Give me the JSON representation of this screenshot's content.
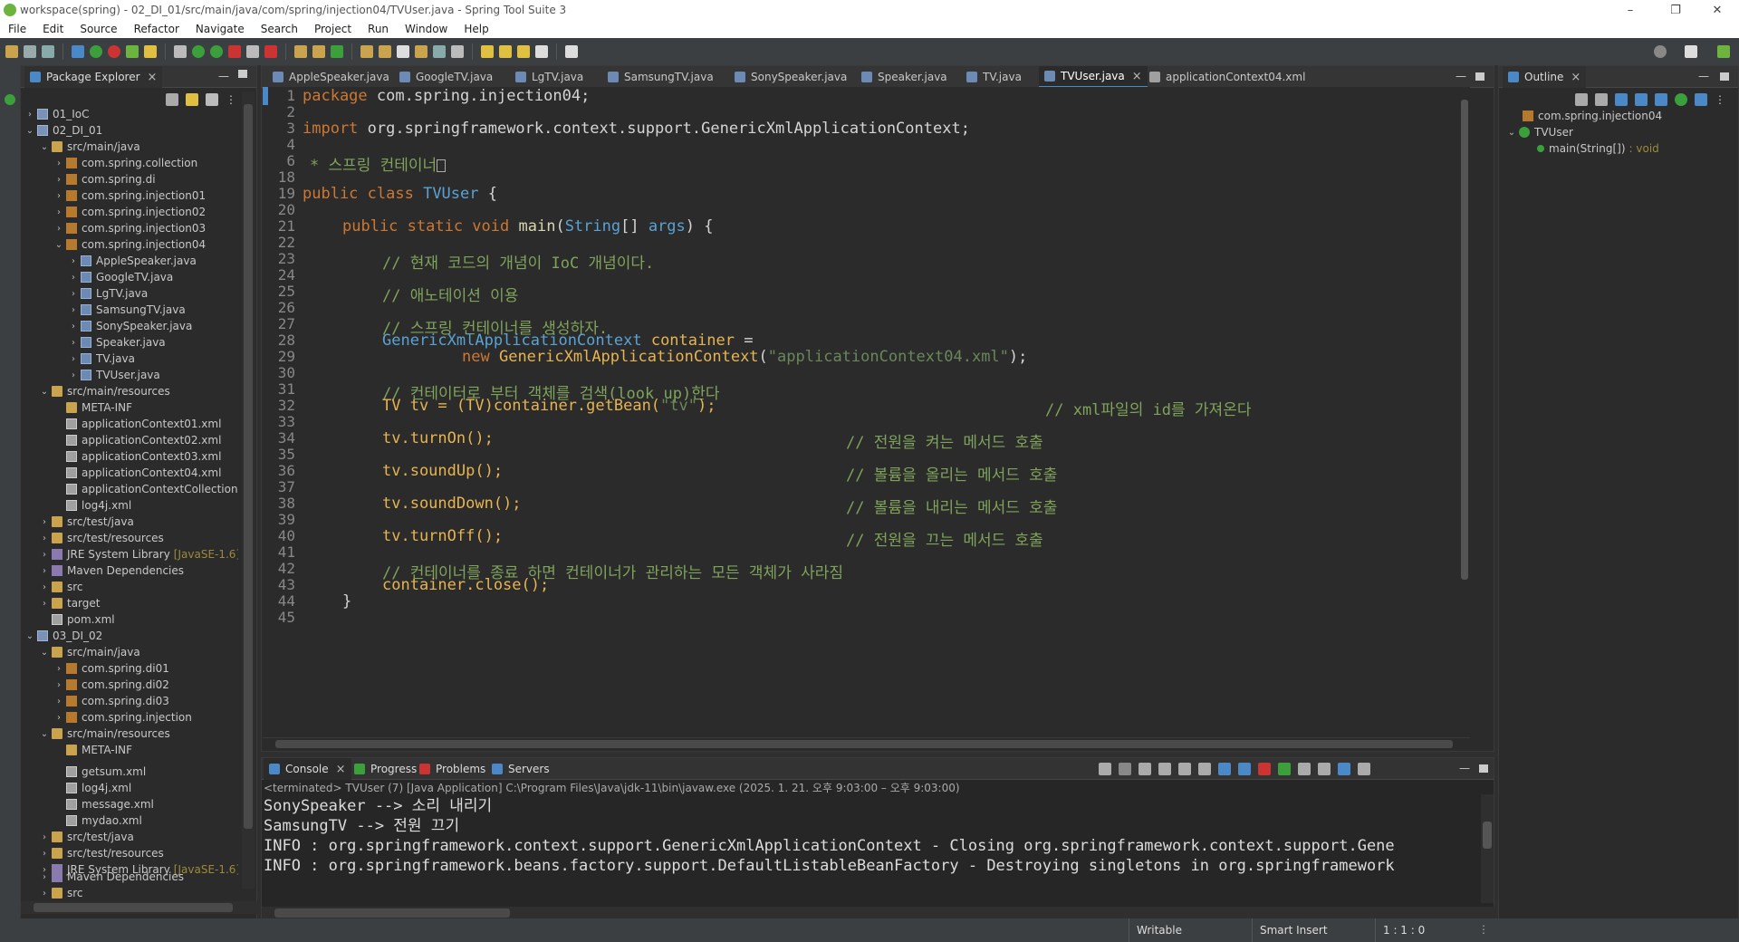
{
  "window": {
    "title": "workspace(spring) - 02_DI_01/src/main/java/com/spring/injection04/TVUser.java - Spring Tool Suite 3"
  },
  "menu": [
    "File",
    "Edit",
    "Source",
    "Refactor",
    "Navigate",
    "Search",
    "Project",
    "Run",
    "Window",
    "Help"
  ],
  "package_explorer": {
    "tab_label": "Package Explorer",
    "items": [
      "01_IoC",
      "02_DI_01",
      "src/main/java",
      "com.spring.collection",
      "com.spring.di",
      "com.spring.injection01",
      "com.spring.injection02",
      "com.spring.injection03",
      "com.spring.injection04",
      "AppleSpeaker.java",
      "GoogleTV.java",
      "LgTV.java",
      "SamsungTV.java",
      "SonySpeaker.java",
      "Speaker.java",
      "TV.java",
      "TVUser.java",
      "src/main/resources",
      "META-INF",
      "applicationContext01.xml",
      "applicationContext02.xml",
      "applicationContext03.xml",
      "applicationContext04.xml",
      "applicationContextCollection.xn",
      "log4j.xml",
      "src/test/java",
      "src/test/resources",
      "JRE System Library",
      "Maven Dependencies",
      "src",
      "target",
      "pom.xml",
      "03_DI_02",
      "src/main/java",
      "com.spring.di01",
      "com.spring.di02",
      "com.spring.di03",
      "com.spring.injection",
      "src/main/resources",
      "META-INF",
      "getsum.xml",
      "log4j.xml",
      "message.xml",
      "mydao.xml",
      "src/test/java",
      "src/test/resources",
      "JRE System Library",
      "Maven Dependencies",
      "src"
    ],
    "jre_suffix": "[JavaSE-1.6]"
  },
  "editor_tabs": [
    "AppleSpeaker.java",
    "GoogleTV.java",
    "LgTV.java",
    "SamsungTV.java",
    "SonySpeaker.java",
    "Speaker.java",
    "TV.java",
    "TVUser.java",
    "applicationContext04.xml"
  ],
  "active_tab": "TVUser.java",
  "code": {
    "line_numbers": [
      "1",
      "2",
      "3",
      "4",
      "6",
      "18",
      "19",
      "20",
      "21",
      "22",
      "23",
      "24",
      "25",
      "26",
      "27",
      "28",
      "29",
      "30",
      "31",
      "32",
      "33",
      "34",
      "35",
      "36",
      "37",
      "38",
      "39",
      "40",
      "41",
      "42",
      "43",
      "44",
      "45"
    ],
    "package_kw": "package",
    "package_name": "com.spring.injection04;",
    "import_kw": "import",
    "import_name": "org.springframework.context.support.GenericXmlApplicationContext;",
    "javadoc": "* 스프링 컨테이너",
    "class_kw": "public class",
    "class_name": "TVUser",
    "brace_open": "{",
    "main_kw": "public static void",
    "main_name": "main",
    "main_param_type": "String",
    "main_param_rest": "[] ",
    "main_param_name": "args",
    "main_tail": ") {",
    "c1": "// 현재 코드의 개념이 IoC 개념이다.",
    "c2": "// 애노테이션 이용",
    "c3": "// 스프링 컨테이너를 생성하자.",
    "l28_type": "GenericXmlApplicationContext",
    "l28_var": "container",
    "l28_eq": " =",
    "l29_new": "new",
    "l29_type": "GenericXmlApplicationContext",
    "l29_open": "(",
    "l29_str": "\"applicationContext04.xml\"",
    "l29_close": ");",
    "c4": "// 컨테이터로 부터 객체를 검색(look up)한다",
    "l32_code": "TV tv = (TV)container.getBean(",
    "l32_str": "\"tv\"",
    "l32_end": ");",
    "l32_cm": "// xml파일의 id를 가져온다",
    "l34_code": "tv.turnOn();",
    "l34_cm": "// 전원을 켜는 메서드 호출",
    "l36_code": "tv.soundUp();",
    "l36_cm": "// 볼륨을 올리는 메서드 호출",
    "l38_code": "tv.soundDown();",
    "l38_cm": "// 볼륨을 내리는 메서드 호출",
    "l40_code": "tv.turnOff();",
    "l40_cm": "// 전원을 끄는 메서드 호출",
    "c5": "// 컨테이너를 종료 하면 컨테이너가 관리하는 모든 객체가 사라짐",
    "l43_code": "container.close();",
    "l44_code": "}"
  },
  "outline": {
    "tab_label": "Outline",
    "package": "com.spring.injection04",
    "class": "TVUser",
    "method": "main(String[])",
    "method_type": ": void"
  },
  "console_tabs": [
    "Console",
    "Progress",
    "Problems",
    "Servers"
  ],
  "console": {
    "terminated": "<terminated> TVUser (7) [Java Application] C:\\Program Files\\Java\\jdk-11\\bin\\javaw.exe  (2025. 1. 21. 오후 9:03:00 – 오후 9:03:00)",
    "lines": [
      "SonySpeaker --> 소리 내리기",
      "SamsungTV --> 전원 끄기",
      "INFO : org.springframework.context.support.GenericXmlApplicationContext - Closing org.springframework.context.support.Gene",
      "INFO : org.springframework.beans.factory.support.DefaultListableBeanFactory - Destroying singletons in org.springframework"
    ]
  },
  "status": {
    "writable": "Writable",
    "insert": "Smart Insert",
    "position": "1 : 1 : 0"
  }
}
